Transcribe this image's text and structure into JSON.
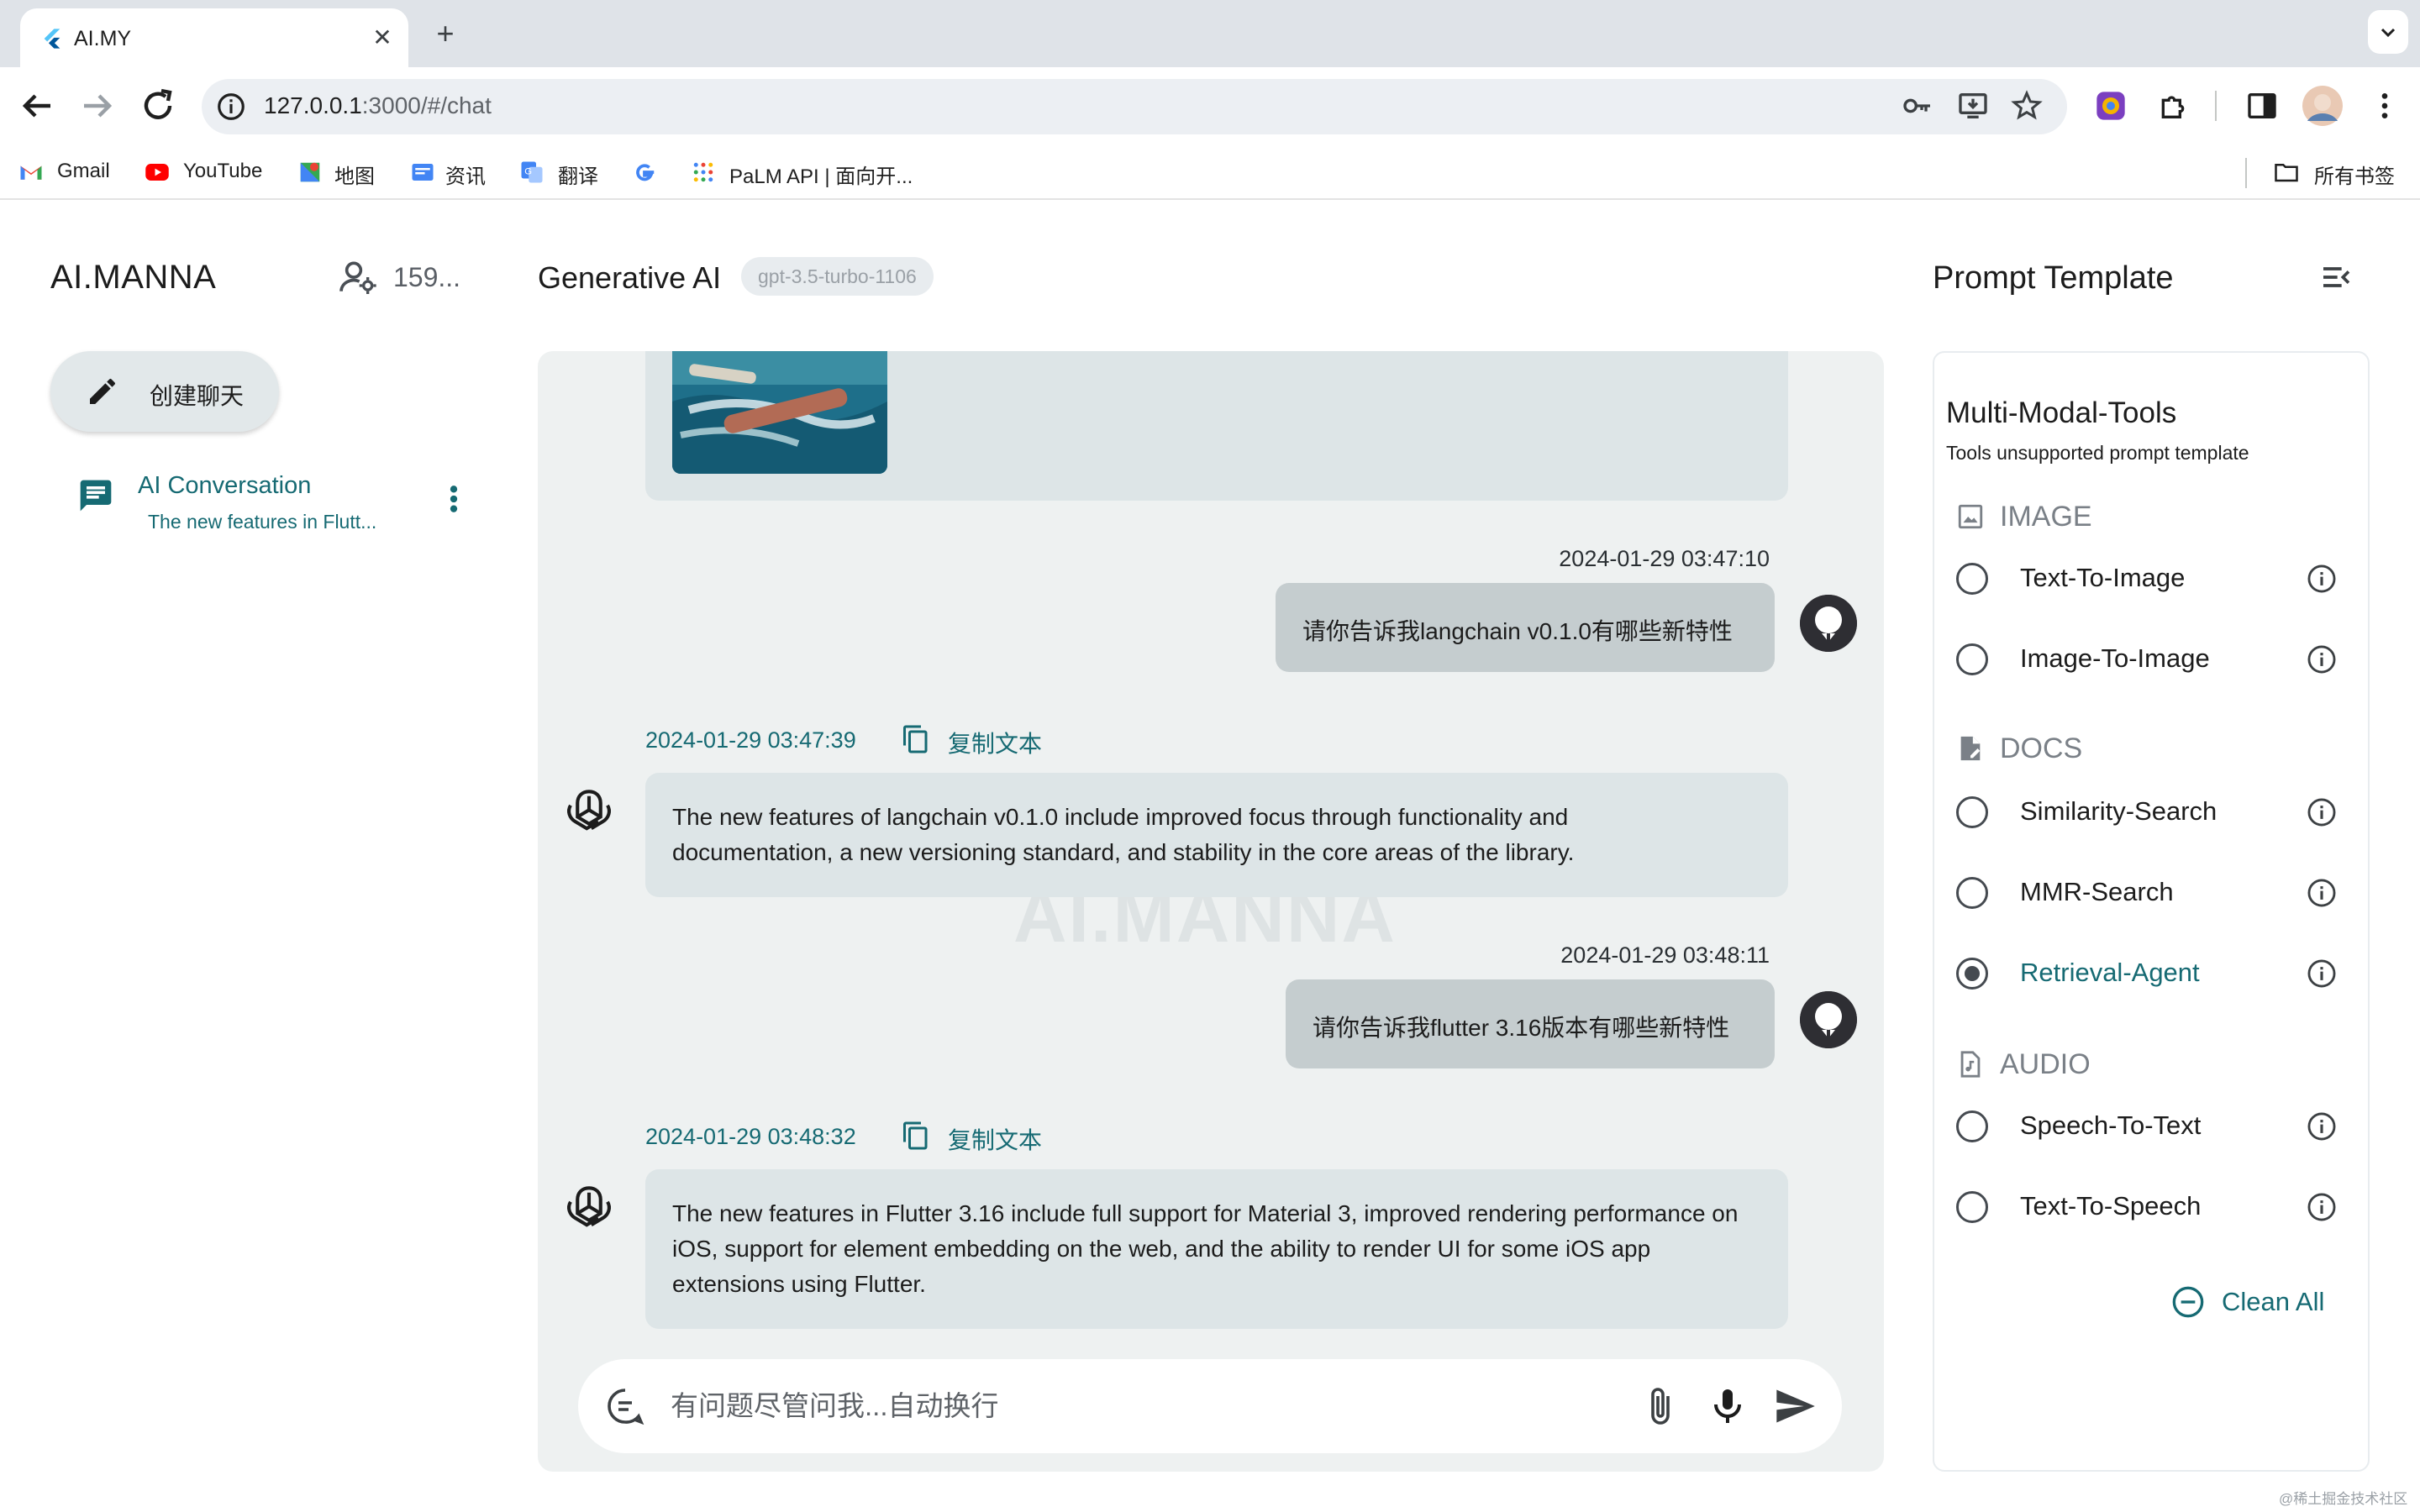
{
  "browser": {
    "tab_title": "AI.MY",
    "url_host": "127.0.0.1",
    "url_rest": ":3000/#/chat",
    "bookmarks": [
      "Gmail",
      "YouTube",
      "地图",
      "资讯",
      "翻译",
      "PaLM API | 面向开..."
    ],
    "all_bookmarks": "所有书签"
  },
  "sidebar": {
    "brand": "AI.MANNA",
    "user_count": "159...",
    "new_chat_label": "创建聊天",
    "conversations": [
      {
        "title": "AI Conversation",
        "subtitle": "The new features in Flutt..."
      }
    ]
  },
  "chat": {
    "title": "Generative AI",
    "model": "gpt-3.5-turbo-1106",
    "watermark": "AI.MANNA",
    "copy_label": "复制文本",
    "messages": [
      {
        "role": "user",
        "time": "2024-01-29 03:47:10",
        "text": "请你告诉我langchain v0.1.0有哪些新特性"
      },
      {
        "role": "ai",
        "time": "2024-01-29 03:47:39",
        "text": "The new features of langchain v0.1.0 include improved focus through functionality and documentation, a new versioning standard, and stability in the core areas of the library."
      },
      {
        "role": "user",
        "time": "2024-01-29 03:48:11",
        "text": "请你告诉我flutter 3.16版本有哪些新特性"
      },
      {
        "role": "ai",
        "time": "2024-01-29 03:48:32",
        "text": "The new features in Flutter 3.16 include full support for Material 3, improved rendering performance on iOS, support for element embedding on the web, and the ability to render UI for some iOS app extensions using Flutter."
      }
    ],
    "input_placeholder": "有问题尽管问我...自动换行"
  },
  "prompt_panel": {
    "title": "Prompt Template",
    "card_title": "Multi-Modal-Tools",
    "card_subtitle": "Tools unsupported prompt template",
    "sections": [
      {
        "label": "IMAGE",
        "options": [
          "Text-To-Image",
          "Image-To-Image"
        ]
      },
      {
        "label": "DOCS",
        "options": [
          "Similarity-Search",
          "MMR-Search",
          "Retrieval-Agent"
        ]
      },
      {
        "label": "AUDIO",
        "options": [
          "Speech-To-Text",
          "Text-To-Speech"
        ]
      }
    ],
    "selected_option": "Retrieval-Agent",
    "clean_all": "Clean All"
  },
  "footer_mark": "@稀土掘金技术社区",
  "colors": {
    "accent": "#166a73",
    "chat_bg": "#eef1f1",
    "ai_bubble": "#dde5e7",
    "user_bubble": "#c5cdcf"
  }
}
